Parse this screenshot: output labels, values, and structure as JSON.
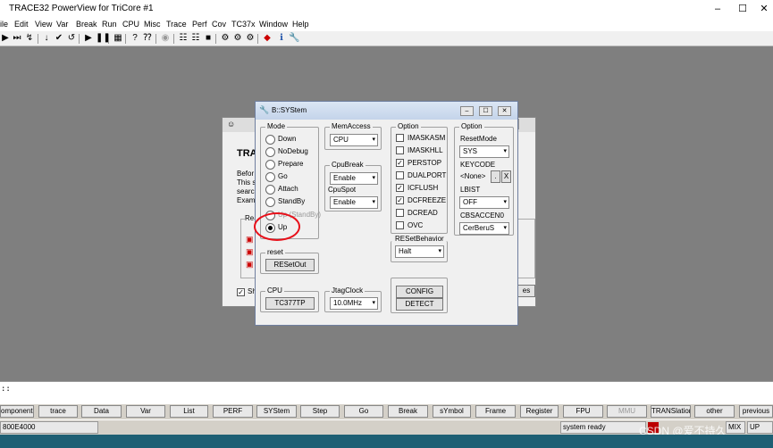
{
  "window": {
    "title": "TRACE32 PowerView for TriCore #1",
    "controls": [
      "–",
      "☐",
      "✕"
    ]
  },
  "menu": [
    "ile",
    "Edit",
    "View",
    "Var",
    "Break",
    "Run",
    "CPU",
    "Misc",
    "Trace",
    "Perf",
    "Cov",
    "TC37x",
    "Window",
    "Help"
  ],
  "welcome": {
    "heading": "TRA",
    "lines": [
      "Befor",
      "This s",
      "searc",
      "Exam"
    ],
    "group": "Re",
    "show_label": "Sh",
    "button_partial": "es"
  },
  "dialog": {
    "title": "B::SYStem",
    "mode": {
      "label": "Mode",
      "options": [
        "Down",
        "NoDebug",
        "Prepare",
        "Go",
        "Attach",
        "StandBy",
        "Up (StandBy)",
        "Up"
      ],
      "selected": "Up"
    },
    "memaccess": {
      "label": "MemAccess",
      "value": "CPU"
    },
    "cpubreak": {
      "label": "CpuBreak",
      "value": "Enable"
    },
    "cpuspot": {
      "label": "CpuSpot",
      "value": "Enable"
    },
    "option": {
      "label": "Option",
      "items": [
        {
          "name": "IMASKASM",
          "checked": false
        },
        {
          "name": "IMASKHLL",
          "checked": false
        },
        {
          "name": "PERSTOP",
          "checked": true
        },
        {
          "name": "DUALPORT",
          "checked": false
        },
        {
          "name": "ICFLUSH",
          "checked": true
        },
        {
          "name": "DCFREEZE",
          "checked": true
        },
        {
          "name": "DCREAD",
          "checked": false
        },
        {
          "name": "OVC",
          "checked": false
        }
      ]
    },
    "resetbehavior": {
      "label": "RESetBehavior",
      "value": "Halt"
    },
    "option2": {
      "label": "Option",
      "resetmode_label": "ResetMode",
      "resetmode_value": "SYS",
      "keycode_label": "KEYCODE",
      "keycode_value": "<None>",
      "keycode_btn1": ".",
      "keycode_btn2": "X",
      "lbist_label": "LBIST",
      "lbist_value": "OFF",
      "cbsaccen_label": "CBSACCEN0",
      "cbsaccen_value": "CerBeruS"
    },
    "reset": {
      "label": "reset",
      "button": "RESetOut"
    },
    "cpu": {
      "label": "CPU",
      "button": "TC377TP"
    },
    "jtag": {
      "label": "JtagClock",
      "value": "10.0MHz"
    },
    "config_button": "CONFIG",
    "detect_button": "DETECT"
  },
  "cmdline": {
    "prompt": "::"
  },
  "softkeys": [
    "omponents",
    "trace",
    "Data",
    "Var",
    "List",
    "PERF",
    "SYStem",
    "Step",
    "Go",
    "Break",
    "sYmbol",
    "Frame",
    "Register",
    "FPU",
    "MMU",
    "TRANSlation",
    "other",
    "previous"
  ],
  "status": {
    "address": "800E4000",
    "message": "system ready",
    "mode": "MIX",
    "up": "UP"
  },
  "watermark": "CSDN @爱不持久",
  "colors": {
    "annotation": "#e8101a",
    "taskbar": "#1e5f74"
  }
}
